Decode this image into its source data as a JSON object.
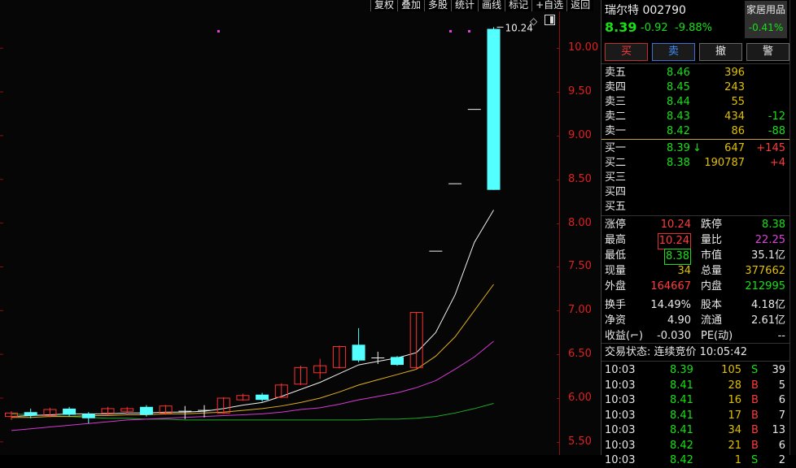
{
  "toolbar": [
    "复权",
    "叠加",
    "多股",
    "统计",
    "画线",
    "标记",
    "+自选",
    "返回"
  ],
  "chart_data": {
    "type": "candlestick",
    "ylim": [
      5.35,
      10.55
    ],
    "y_ticks": [
      "10.00",
      "9.50",
      "9.00",
      "8.50",
      "8.00",
      "7.50",
      "7.00",
      "6.50",
      "6.00",
      "5.50"
    ],
    "high_label": "10.24",
    "candles": [
      {
        "o": 5.79,
        "c": 5.83,
        "h": 5.85,
        "l": 5.75
      },
      {
        "o": 5.84,
        "c": 5.8,
        "h": 5.88,
        "l": 5.77
      },
      {
        "o": 5.8,
        "c": 5.87,
        "h": 5.89,
        "l": 5.78
      },
      {
        "o": 5.88,
        "c": 5.81,
        "h": 5.9,
        "l": 5.79
      },
      {
        "o": 5.82,
        "c": 5.77,
        "h": 5.84,
        "l": 5.71
      },
      {
        "o": 5.83,
        "c": 5.88,
        "h": 5.9,
        "l": 5.8
      },
      {
        "o": 5.85,
        "c": 5.88,
        "h": 5.9,
        "l": 5.82
      },
      {
        "o": 5.9,
        "c": 5.81,
        "h": 5.92,
        "l": 5.79
      },
      {
        "o": 5.83,
        "c": 5.91,
        "h": 5.92,
        "l": 5.81
      },
      {
        "o": 5.85,
        "c": 5.85,
        "h": 5.91,
        "l": 5.76
      },
      {
        "o": 5.86,
        "c": 5.86,
        "h": 5.92,
        "l": 5.78
      },
      {
        "o": 5.83,
        "c": 6.0,
        "h": 6.01,
        "l": 5.82
      },
      {
        "o": 5.98,
        "c": 6.03,
        "h": 6.05,
        "l": 5.97
      },
      {
        "o": 6.04,
        "c": 5.98,
        "h": 6.06,
        "l": 5.96
      },
      {
        "o": 6.01,
        "c": 6.15,
        "h": 6.17,
        "l": 6.0
      },
      {
        "o": 6.16,
        "c": 6.35,
        "h": 6.37,
        "l": 6.15
      },
      {
        "o": 6.29,
        "c": 6.37,
        "h": 6.45,
        "l": 6.22
      },
      {
        "o": 6.35,
        "c": 6.59,
        "h": 6.6,
        "l": 6.34
      },
      {
        "o": 6.61,
        "c": 6.43,
        "h": 6.8,
        "l": 6.41
      },
      {
        "o": 6.46,
        "c": 6.46,
        "h": 6.53,
        "l": 6.39
      },
      {
        "o": 6.47,
        "c": 6.38,
        "h": 6.48,
        "l": 6.37
      },
      {
        "o": 6.35,
        "c": 6.98,
        "h": 6.98,
        "l": 6.33
      },
      {
        "o": 7.68,
        "c": 7.68,
        "h": 7.68,
        "l": 7.68
      },
      {
        "o": 8.45,
        "c": 8.45,
        "h": 8.45,
        "l": 8.45
      },
      {
        "o": 9.3,
        "c": 9.3,
        "h": 9.3,
        "l": 9.3
      },
      {
        "o": 10.22,
        "c": 8.38,
        "h": 10.24,
        "l": 8.38
      }
    ],
    "ma5": [
      5.79,
      5.8,
      5.81,
      5.82,
      5.82,
      5.82,
      5.83,
      5.83,
      5.84,
      5.84,
      5.85,
      5.88,
      5.92,
      5.95,
      6.02,
      6.1,
      6.18,
      6.28,
      6.38,
      6.42,
      6.46,
      6.52,
      6.75,
      7.18,
      7.78,
      8.15
    ],
    "ma10": [
      5.78,
      5.78,
      5.79,
      5.79,
      5.8,
      5.8,
      5.81,
      5.81,
      5.82,
      5.82,
      5.83,
      5.84,
      5.86,
      5.88,
      5.91,
      5.95,
      6.0,
      6.07,
      6.15,
      6.21,
      6.27,
      6.33,
      6.48,
      6.7,
      7.0,
      7.3
    ],
    "ma20": [
      5.63,
      5.65,
      5.67,
      5.69,
      5.71,
      5.73,
      5.75,
      5.76,
      5.77,
      5.78,
      5.79,
      5.8,
      5.81,
      5.82,
      5.84,
      5.87,
      5.89,
      5.93,
      5.98,
      6.02,
      6.06,
      6.12,
      6.2,
      6.33,
      6.47,
      6.65
    ],
    "ma60": [
      5.82,
      5.81,
      5.8,
      5.79,
      5.78,
      5.77,
      5.77,
      5.76,
      5.76,
      5.75,
      5.75,
      5.75,
      5.75,
      5.75,
      5.75,
      5.75,
      5.75,
      5.75,
      5.75,
      5.76,
      5.76,
      5.77,
      5.79,
      5.83,
      5.88,
      5.94
    ]
  },
  "quote": {
    "name_code": "瑞尔特 002790",
    "price": "8.39",
    "change": "-0.92",
    "change_pct": "-9.88%",
    "sector": "家居用品",
    "sector_pct": "-0.41%",
    "buttons": [
      "买",
      "卖",
      "撤",
      "警"
    ]
  },
  "asks": [
    {
      "label": "卖五",
      "price": "8.46",
      "vol": "396",
      "delta": ""
    },
    {
      "label": "卖四",
      "price": "8.45",
      "vol": "243",
      "delta": ""
    },
    {
      "label": "卖三",
      "price": "8.44",
      "vol": "55",
      "delta": ""
    },
    {
      "label": "卖二",
      "price": "8.43",
      "vol": "434",
      "delta": "-12"
    },
    {
      "label": "卖一",
      "price": "8.42",
      "vol": "86",
      "delta": "-88"
    }
  ],
  "bids": [
    {
      "label": "买一",
      "price": "8.39",
      "arrow": "↓",
      "vol": "647",
      "delta": "+145"
    },
    {
      "label": "买二",
      "price": "8.38",
      "arrow": "",
      "vol": "190787",
      "delta": "+4"
    },
    {
      "label": "买三",
      "price": "",
      "arrow": "",
      "vol": "",
      "delta": ""
    },
    {
      "label": "买四",
      "price": "",
      "arrow": "",
      "vol": "",
      "delta": ""
    },
    {
      "label": "买五",
      "price": "",
      "arrow": "",
      "vol": "",
      "delta": ""
    }
  ],
  "stats": [
    [
      "涨停",
      "10.24",
      "跌停",
      "8.38"
    ],
    [
      "最高",
      "10.24",
      "量比",
      "22.25"
    ],
    [
      "最低",
      "8.38",
      "市值",
      "35.1亿"
    ],
    [
      "现量",
      "34",
      "总量",
      "377662"
    ],
    [
      "外盘",
      "164667",
      "内盘",
      "212995"
    ],
    [
      "换手",
      "14.49%",
      "股本",
      "4.18亿"
    ],
    [
      "净资",
      "4.90",
      "流通",
      "2.61亿"
    ],
    [
      "收益(⌐)",
      "-0.030",
      "PE(动)",
      "--"
    ]
  ],
  "trade_status": "交易状态: 连续竞价 10:05:42",
  "ticks": [
    {
      "t": "10:03",
      "p": "8.39",
      "v": "105",
      "s": "S",
      "n": "39"
    },
    {
      "t": "10:03",
      "p": "8.41",
      "v": "28",
      "s": "B",
      "n": "5"
    },
    {
      "t": "10:03",
      "p": "8.41",
      "v": "16",
      "s": "B",
      "n": "6"
    },
    {
      "t": "10:03",
      "p": "8.41",
      "v": "17",
      "s": "B",
      "n": "7"
    },
    {
      "t": "10:03",
      "p": "8.41",
      "v": "34",
      "s": "B",
      "n": "13"
    },
    {
      "t": "10:03",
      "p": "8.42",
      "v": "21",
      "s": "B",
      "n": "6"
    },
    {
      "t": "10:03",
      "p": "8.42",
      "v": "1",
      "s": "S",
      "n": "2"
    }
  ]
}
